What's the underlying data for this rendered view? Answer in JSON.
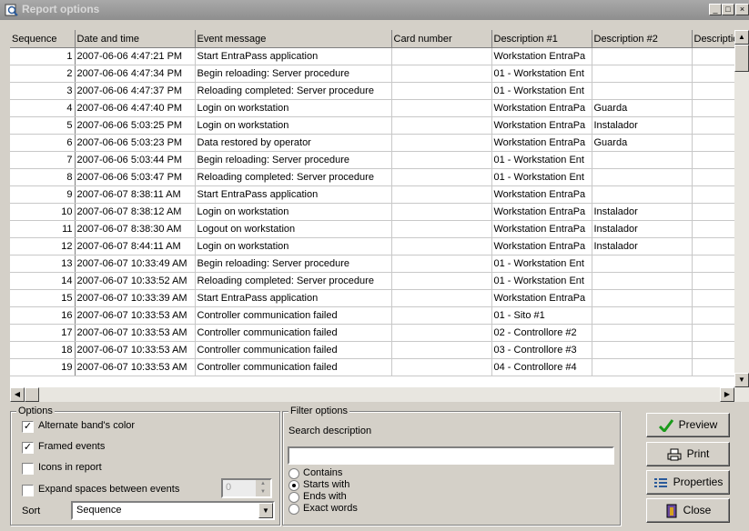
{
  "window": {
    "title": "Report options"
  },
  "columns": [
    "Sequence",
    "Date and time",
    "Event message",
    "Card number",
    "Description #1",
    "Description #2",
    "Descriptio"
  ],
  "rows": [
    {
      "seq": "1",
      "dt": "2007-06-06 4:47:21 PM",
      "msg": "Start EntraPass application",
      "card": "",
      "d1": "Workstation EntraPa",
      "d2": ""
    },
    {
      "seq": "2",
      "dt": "2007-06-06 4:47:34 PM",
      "msg": "Begin reloading: Server procedure",
      "card": "",
      "d1": "01 - Workstation Ent",
      "d2": ""
    },
    {
      "seq": "3",
      "dt": "2007-06-06 4:47:37 PM",
      "msg": "Reloading completed: Server procedure",
      "card": "",
      "d1": "01 - Workstation Ent",
      "d2": ""
    },
    {
      "seq": "4",
      "dt": "2007-06-06 4:47:40 PM",
      "msg": "Login on workstation",
      "card": "",
      "d1": "Workstation EntraPa",
      "d2": "Guarda"
    },
    {
      "seq": "5",
      "dt": "2007-06-06 5:03:25 PM",
      "msg": "Login on workstation",
      "card": "",
      "d1": "Workstation EntraPa",
      "d2": "Instalador"
    },
    {
      "seq": "6",
      "dt": "2007-06-06 5:03:23 PM",
      "msg": "Data restored by operator",
      "card": "",
      "d1": "Workstation EntraPa",
      "d2": "Guarda"
    },
    {
      "seq": "7",
      "dt": "2007-06-06 5:03:44 PM",
      "msg": "Begin reloading: Server procedure",
      "card": "",
      "d1": "01 - Workstation Ent",
      "d2": ""
    },
    {
      "seq": "8",
      "dt": "2007-06-06 5:03:47 PM",
      "msg": "Reloading completed: Server procedure",
      "card": "",
      "d1": "01 - Workstation Ent",
      "d2": ""
    },
    {
      "seq": "9",
      "dt": "2007-06-07 8:38:11 AM",
      "msg": "Start EntraPass application",
      "card": "",
      "d1": "Workstation EntraPa",
      "d2": ""
    },
    {
      "seq": "10",
      "dt": "2007-06-07 8:38:12 AM",
      "msg": "Login on workstation",
      "card": "",
      "d1": "Workstation EntraPa",
      "d2": "Instalador"
    },
    {
      "seq": "11",
      "dt": "2007-06-07 8:38:30 AM",
      "msg": "Logout on workstation",
      "card": "",
      "d1": "Workstation EntraPa",
      "d2": "Instalador"
    },
    {
      "seq": "12",
      "dt": "2007-06-07 8:44:11 AM",
      "msg": "Login on workstation",
      "card": "",
      "d1": "Workstation EntraPa",
      "d2": "Instalador"
    },
    {
      "seq": "13",
      "dt": "2007-06-07 10:33:49 AM",
      "msg": "Begin reloading: Server procedure",
      "card": "",
      "d1": "01 - Workstation Ent",
      "d2": ""
    },
    {
      "seq": "14",
      "dt": "2007-06-07 10:33:52 AM",
      "msg": "Reloading completed: Server procedure",
      "card": "",
      "d1": "01 - Workstation Ent",
      "d2": ""
    },
    {
      "seq": "15",
      "dt": "2007-06-07 10:33:39 AM",
      "msg": "Start EntraPass application",
      "card": "",
      "d1": "Workstation EntraPa",
      "d2": ""
    },
    {
      "seq": "16",
      "dt": "2007-06-07 10:33:53 AM",
      "msg": "Controller communication failed",
      "card": "",
      "d1": "01 - Sito #1",
      "d2": ""
    },
    {
      "seq": "17",
      "dt": "2007-06-07 10:33:53 AM",
      "msg": "Controller communication failed",
      "card": "",
      "d1": "02 - Controllore #2",
      "d2": ""
    },
    {
      "seq": "18",
      "dt": "2007-06-07 10:33:53 AM",
      "msg": "Controller communication failed",
      "card": "",
      "d1": "03 - Controllore #3",
      "d2": ""
    },
    {
      "seq": "19",
      "dt": "2007-06-07 10:33:53 AM",
      "msg": "Controller communication failed",
      "card": "",
      "d1": "04 - Controllore #4",
      "d2": ""
    }
  ],
  "options": {
    "title": "Options",
    "alternate_label": "Alternate band's color",
    "alternate_checked": true,
    "framed_label": "Framed events",
    "framed_checked": true,
    "icons_label": "Icons in report",
    "icons_checked": false,
    "expand_label": "Expand spaces between events",
    "expand_checked": false,
    "expand_value": "0",
    "sort_label": "Sort",
    "sort_value": "Sequence"
  },
  "filter": {
    "title": "Filter options",
    "search_label": "Search description",
    "search_value": "",
    "radios": [
      {
        "label": "Contains",
        "selected": false
      },
      {
        "label": "Starts with",
        "selected": true
      },
      {
        "label": "Ends with",
        "selected": false
      },
      {
        "label": "Exact words",
        "selected": false
      }
    ]
  },
  "buttons": {
    "preview": "Preview",
    "print": "Print",
    "properties": "Properties",
    "close": "Close"
  },
  "colors": {
    "title_bar": "#8e8e8e",
    "preview_check": "#1a9a1a"
  },
  "icons": {
    "preview": "checkmark-icon",
    "print": "printer-icon",
    "properties": "properties-icon",
    "close": "door-icon"
  }
}
